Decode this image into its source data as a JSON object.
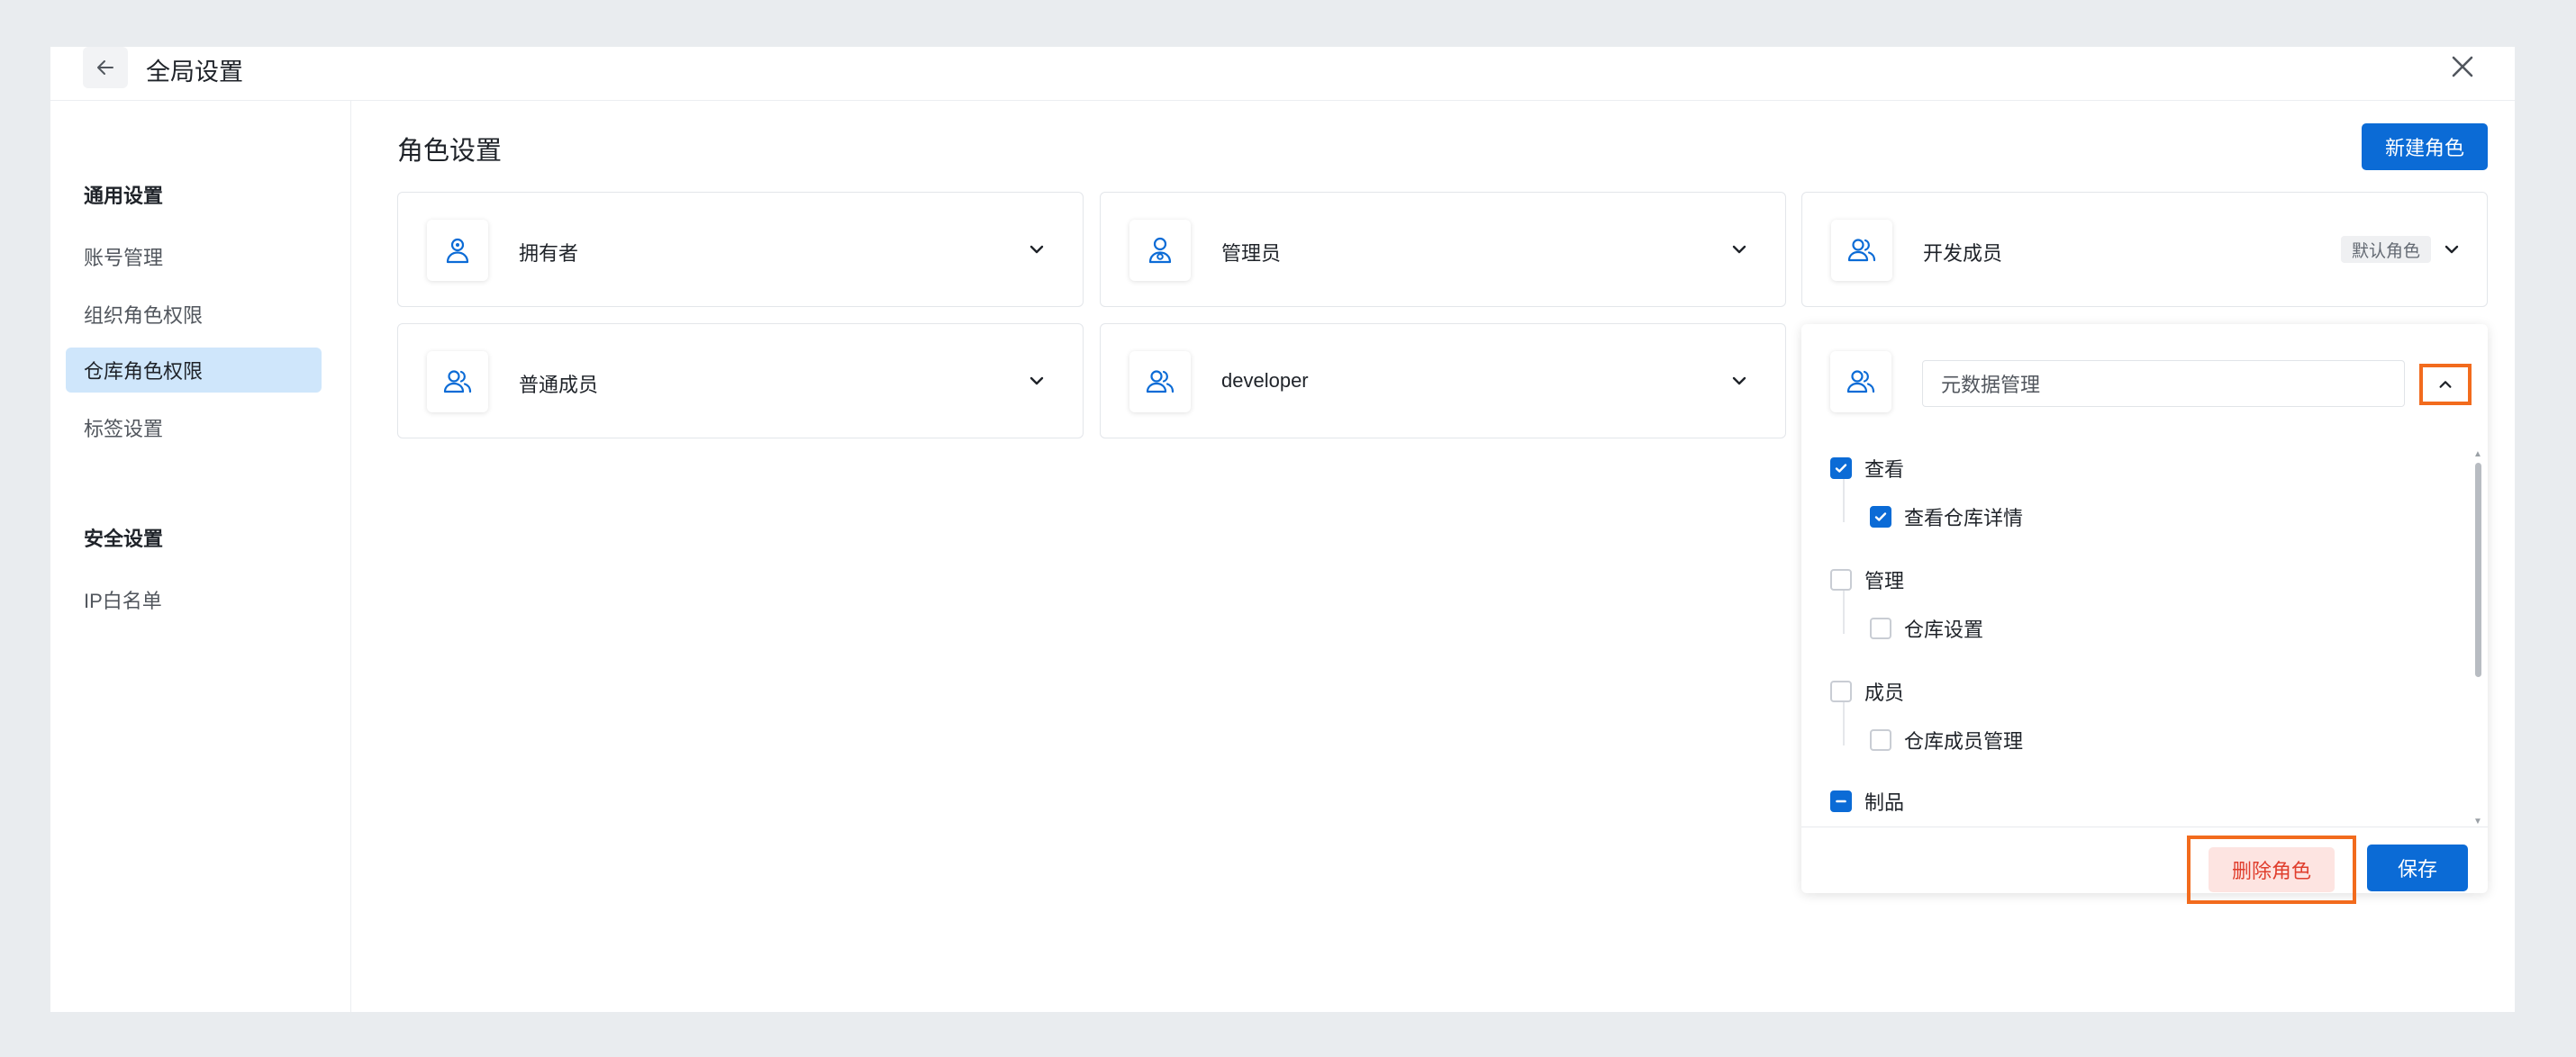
{
  "header": {
    "title": "全局设置"
  },
  "sidebar": {
    "section_general": "通用设置",
    "items_general": [
      "账号管理",
      "组织角色权限",
      "仓库角色权限",
      "标签设置"
    ],
    "section_security": "安全设置",
    "items_security": [
      "IP白名单"
    ],
    "active_item": "仓库角色权限"
  },
  "main": {
    "title": "角色设置",
    "new_role_label": "新建角色",
    "roles": [
      {
        "name": "拥有者"
      },
      {
        "name": "管理员"
      },
      {
        "name": "开发成员",
        "badge": "默认角色"
      },
      {
        "name": "普通成员"
      },
      {
        "name": "developer"
      }
    ],
    "editing_role": {
      "name_value": "元数据管理",
      "permissions": [
        {
          "label": "查看",
          "state": "checked",
          "children": [
            {
              "label": "查看仓库详情",
              "state": "checked"
            }
          ]
        },
        {
          "label": "管理",
          "state": "unchecked",
          "children": [
            {
              "label": "仓库设置",
              "state": "unchecked"
            }
          ]
        },
        {
          "label": "成员",
          "state": "unchecked",
          "children": [
            {
              "label": "仓库成员管理",
              "state": "unchecked"
            }
          ]
        },
        {
          "label": "制品",
          "state": "indeterminate",
          "children": []
        }
      ],
      "delete_label": "删除角色",
      "save_label": "保存"
    }
  },
  "colors": {
    "primary": "#0b6bd6",
    "highlight": "#f26b1d",
    "danger": "#e03e2d",
    "active_bg": "#cfe6fb"
  }
}
